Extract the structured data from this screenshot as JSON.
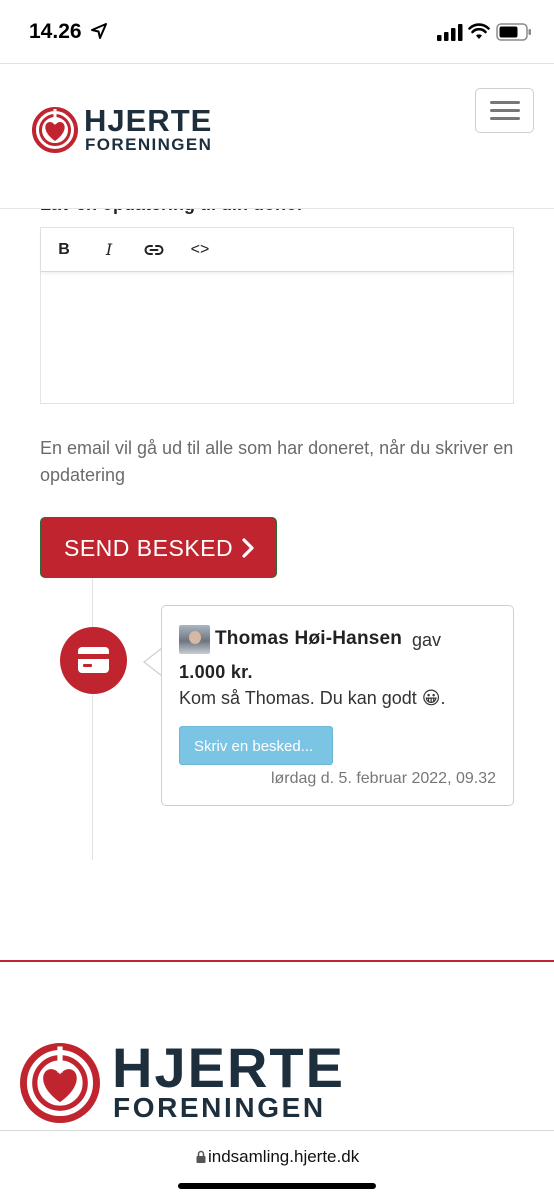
{
  "status_bar": {
    "time": "14.26"
  },
  "header": {
    "logo_line1": "HJERTE",
    "logo_line2": "FORENINGEN",
    "brand_color": "#c0252f",
    "text_color": "#1d2e3d"
  },
  "update": {
    "heading": "Lav en opdatering til din donor",
    "toolbar": {
      "bold": "B",
      "italic": "I",
      "link_icon": "link-icon",
      "code": "<>"
    },
    "editor_value": "",
    "info_text": "En email vil gå ud til alle som har doneret, når du skriver en opdatering",
    "send_label": "SEND BESKED"
  },
  "timeline": {
    "icon": "credit-card-icon",
    "donation": {
      "donor_name": "Thomas Høi-Hansen",
      "verb": "gav",
      "amount": "1.000 kr.",
      "message": "Kom så Thomas. Du kan godt 😀.",
      "reply_label": "Skriv en besked...",
      "timestamp": "lørdag d. 5. februar 2022, 09.32"
    }
  },
  "footer": {
    "logo_line1": "HJERTE",
    "logo_line2": "FORENINGEN"
  },
  "browser": {
    "url": "indsamling.hjerte.dk"
  }
}
